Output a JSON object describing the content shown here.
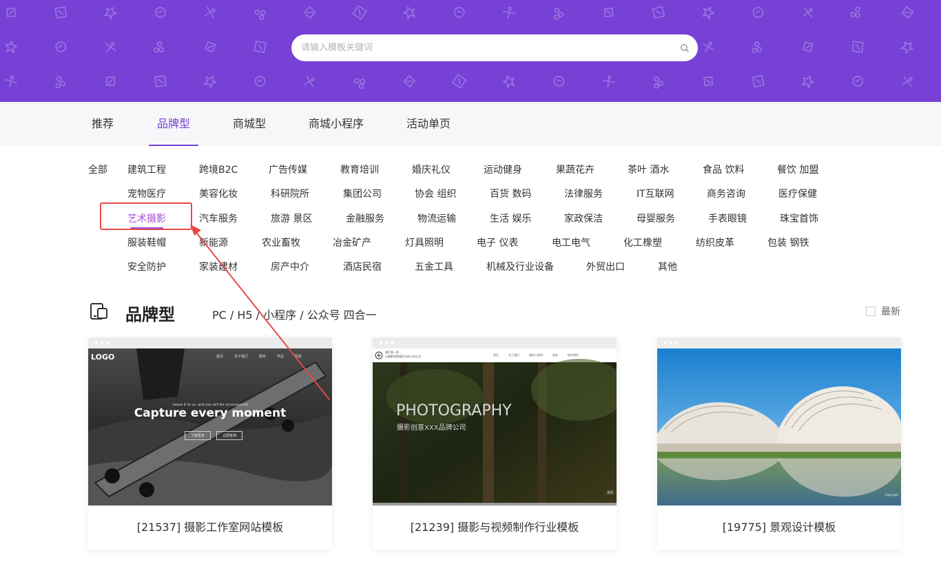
{
  "search": {
    "placeholder": "请输入模板关键词"
  },
  "colors": {
    "brand": "#7741d6",
    "highlight": "#e84848",
    "active_category": "#a44fd9"
  },
  "tabs": [
    {
      "label": "推荐"
    },
    {
      "label": "品牌型",
      "active": true
    },
    {
      "label": "商城型"
    },
    {
      "label": "商城小程序"
    },
    {
      "label": "活动单页"
    }
  ],
  "categories": {
    "all_label": "全部",
    "rows": [
      [
        "建筑工程",
        "跨境B2C",
        "广告传媒",
        "教育培训",
        "婚庆礼仪",
        "运动健身",
        "果蔬花卉",
        "茶叶 酒水",
        "食品 饮料",
        "餐饮 加盟"
      ],
      [
        "宠物医疗",
        "美容化妆",
        "科研院所",
        "集团公司",
        "协会 组织",
        "百货 数码",
        "法律服务",
        "IT互联网",
        "商务咨询",
        "医疗保健"
      ],
      [
        "艺术摄影",
        "汽车服务",
        "旅游 景区",
        "金融服务",
        "物流运输",
        "生活 娱乐",
        "家政保洁",
        "母婴服务",
        "手表眼镜",
        "珠宝首饰"
      ],
      [
        "服装鞋帽",
        "新能源",
        "农业畜牧",
        "冶金矿产",
        "灯具照明",
        "电子 仪表",
        "电工电气",
        "化工橡塑",
        "纺织皮革",
        "包装 钢铁"
      ],
      [
        "安全防护",
        "家装建材",
        "房产中介",
        "酒店民宿",
        "五金工具",
        "机械及行业设备",
        "外贸出口",
        "其他"
      ]
    ],
    "active": "艺术摄影"
  },
  "section": {
    "title": "品牌型",
    "subtitle": "PC / H5 / 小程序 / 公众号 四合一",
    "newest_label": "最新"
  },
  "cards": [
    {
      "title": "[21537] 摄影工作室网站模板",
      "preview": {
        "logo": "LOGO",
        "headline": "Capture every moment",
        "tagline": "Leave it to us, and you will be unconquered",
        "nav": [
          "首页",
          "关于我们",
          "服务",
          "作品",
          "联系"
        ],
        "buttons": [
          "了解更多",
          "立即咨询"
        ]
      }
    },
    {
      "title": "[21239] 摄影与视频制作行业模板",
      "preview": {
        "brand_line1": "我们是一家",
        "brand_line2": "以摄影视频服务为核心的公司",
        "nav": [
          "首页",
          "关于我们",
          "服务与案例",
          "新闻",
          "联系我们"
        ],
        "headline": "PHOTOGRAPHY",
        "subline": "摄影创意XXX品牌公司",
        "corner": "摄影"
      }
    },
    {
      "title": "[19775] 景观设计模板",
      "preview": {
        "corner": "Copyright"
      }
    }
  ]
}
